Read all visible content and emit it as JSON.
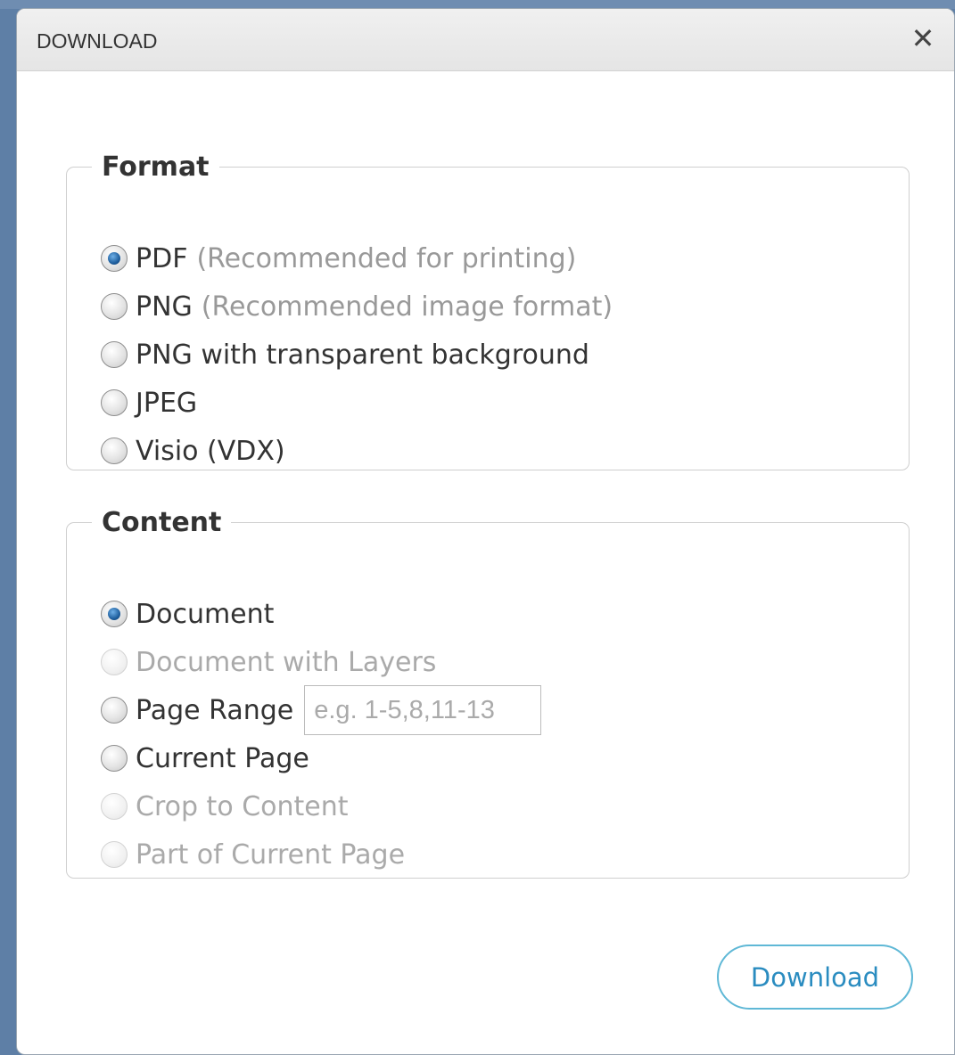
{
  "dialog": {
    "title": "DOWNLOAD",
    "close_glyph": "✕"
  },
  "format": {
    "legend": "Format",
    "options": [
      {
        "label": "PDF",
        "hint": "(Recommended for printing)",
        "checked": true,
        "disabled": false
      },
      {
        "label": "PNG",
        "hint": "(Recommended image format)",
        "checked": false,
        "disabled": false
      },
      {
        "label": "PNG with transparent background",
        "hint": "",
        "checked": false,
        "disabled": false
      },
      {
        "label": "JPEG",
        "hint": "",
        "checked": false,
        "disabled": false
      },
      {
        "label": "Visio (VDX)",
        "hint": "",
        "checked": false,
        "disabled": false
      }
    ]
  },
  "content": {
    "legend": "Content",
    "options": [
      {
        "label": "Document",
        "checked": true,
        "disabled": false
      },
      {
        "label": "Document with Layers",
        "checked": false,
        "disabled": true
      },
      {
        "label": "Page Range",
        "checked": false,
        "disabled": false
      },
      {
        "label": "Current Page",
        "checked": false,
        "disabled": false
      },
      {
        "label": "Crop to Content",
        "checked": false,
        "disabled": true
      },
      {
        "label": "Part of Current Page",
        "checked": false,
        "disabled": true
      }
    ],
    "page_range": {
      "value": "",
      "placeholder": "e.g. 1-5,8,11-13"
    }
  },
  "footer": {
    "download_label": "Download",
    "accent_color": "#2a8cc0"
  },
  "icons": {
    "close": "close-icon",
    "radio_checked": "radio-checked-icon",
    "radio_unchecked": "radio-unchecked-icon"
  }
}
